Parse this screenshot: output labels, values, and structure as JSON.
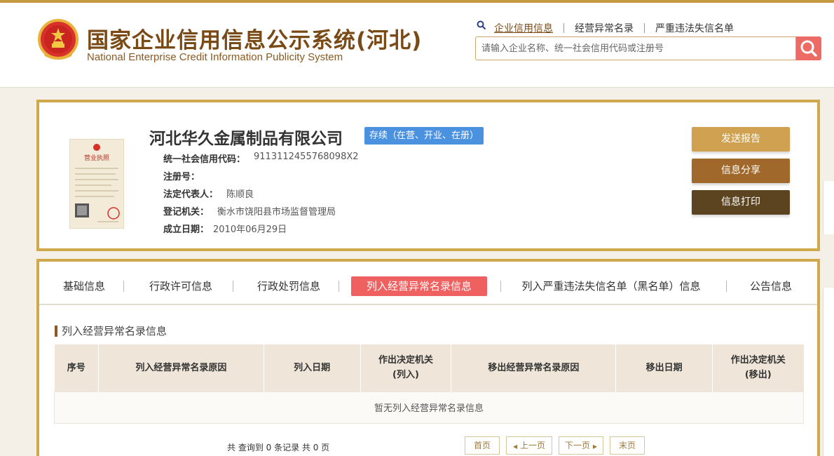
{
  "header": {
    "title": "国家企业信用信息公示系统(河北)",
    "subtitle": "National Enterprise Credit Information Publicity System",
    "emblem_icon": "national-emblem-icon",
    "links": [
      {
        "label": "企业信用信息",
        "active": true
      },
      {
        "label": "经营异常名录",
        "active": false
      },
      {
        "label": "严重违法失信名单",
        "active": false
      }
    ],
    "search": {
      "placeholder": "请输入企业名称、统一社会信用代码或注册号",
      "value": ""
    }
  },
  "company": {
    "name": "河北华久金属制品有限公司",
    "status": "存续（在营、开业、在册）",
    "license_image": "business-license-icon",
    "fields": [
      {
        "label": "统一社会信用代码：",
        "value": "9113112455768098X2"
      },
      {
        "label": "注册号：",
        "value": ""
      },
      {
        "label": "法定代表人：",
        "value": "陈顺良"
      },
      {
        "label": "登记机关：",
        "value": "衡水市饶阳县市场监督管理局"
      },
      {
        "label": "成立日期：",
        "value": "2010年06月29日"
      }
    ],
    "actions": [
      {
        "label": "发送报告",
        "color": "#cfa150"
      },
      {
        "label": "信息分享",
        "color": "#a0682a"
      },
      {
        "label": "信息打印",
        "color": "#5c4420"
      }
    ]
  },
  "tabs": [
    {
      "label": "基础信息",
      "active": false
    },
    {
      "label": "行政许可信息",
      "active": false
    },
    {
      "label": "行政处罚信息",
      "active": false
    },
    {
      "label": "列入经营异常名录信息",
      "active": true
    },
    {
      "label": "列入严重违法失信名单（黑名单）信息",
      "active": false
    },
    {
      "label": "公告信息",
      "active": false
    }
  ],
  "section": {
    "title": "列入经营异常名录信息",
    "columns": [
      {
        "line1": "序号",
        "line2": ""
      },
      {
        "line1": "列入经营异常名录原因",
        "line2": ""
      },
      {
        "line1": "列入日期",
        "line2": ""
      },
      {
        "line1": "作出决定机关",
        "line2": "(列入)"
      },
      {
        "line1": "移出经营异常名录原因",
        "line2": ""
      },
      {
        "line1": "移出日期",
        "line2": ""
      },
      {
        "line1": "作出决定机关",
        "line2": "(移出)"
      }
    ],
    "empty_text": "暂无列入经营异常名录信息",
    "count_text": "共 查询到 0 条记录 共 0 页",
    "pager": {
      "first": "首页",
      "prev": "上一页",
      "next": "下一页",
      "last": "末页"
    }
  },
  "colors": {
    "brand": "#7a4a16",
    "border_gold": "#d1a94d",
    "active_tab": "#ef6161",
    "status_blue": "#4a92e0",
    "search_button": "#ec6b65"
  }
}
